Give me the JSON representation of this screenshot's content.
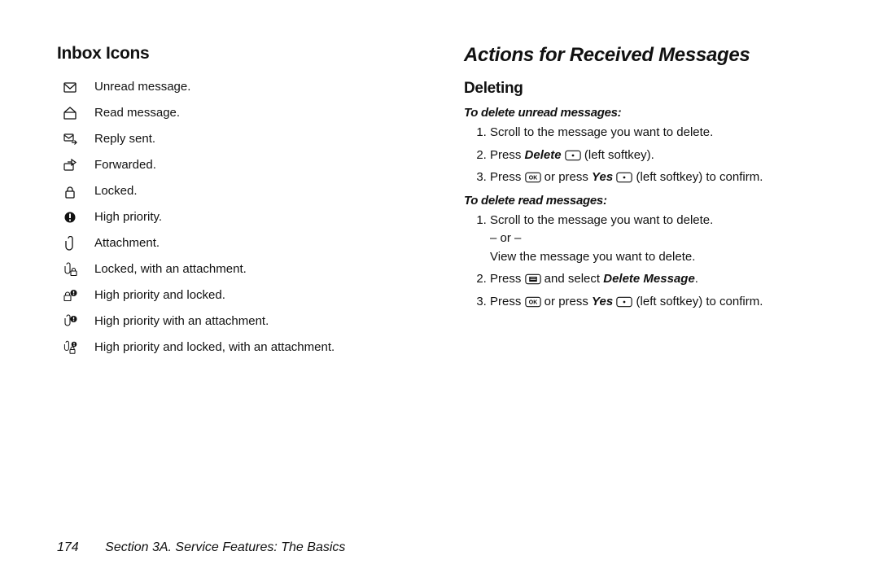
{
  "left": {
    "heading": "Inbox Icons",
    "items": [
      {
        "label": "Unread message."
      },
      {
        "label": "Read message."
      },
      {
        "label": "Reply sent."
      },
      {
        "label": "Forwarded."
      },
      {
        "label": "Locked."
      },
      {
        "label": "High priority."
      },
      {
        "label": "Attachment."
      },
      {
        "label": "Locked, with an attachment."
      },
      {
        "label": "High priority and locked."
      },
      {
        "label": "High priority with an attachment."
      },
      {
        "label": "High priority and locked, with an attachment."
      }
    ]
  },
  "right": {
    "heading": "Actions for Received Messages",
    "sub": "Deleting",
    "instr1": "To delete unread messages:",
    "steps1": {
      "s1": "Scroll to the message you want to delete.",
      "s2a": "Press ",
      "s2b": "Delete",
      "s2c": " (left softkey).",
      "s3a": "Press ",
      "s3b": " or press ",
      "s3c": "Yes",
      "s3d": " (left softkey) to confirm."
    },
    "instr2": "To delete read messages:",
    "steps2": {
      "s1": "Scroll to the message you want to delete.\n– or –\nView the message you want to delete.",
      "s2a": "Press ",
      "s2b": " and select ",
      "s2c": "Delete Message",
      "s2d": ".",
      "s3a": "Press ",
      "s3b": " or press ",
      "s3c": "Yes",
      "s3d": " (left softkey) to confirm."
    }
  },
  "footer": {
    "page": "174",
    "section": "Section 3A. Service Features: The Basics"
  }
}
